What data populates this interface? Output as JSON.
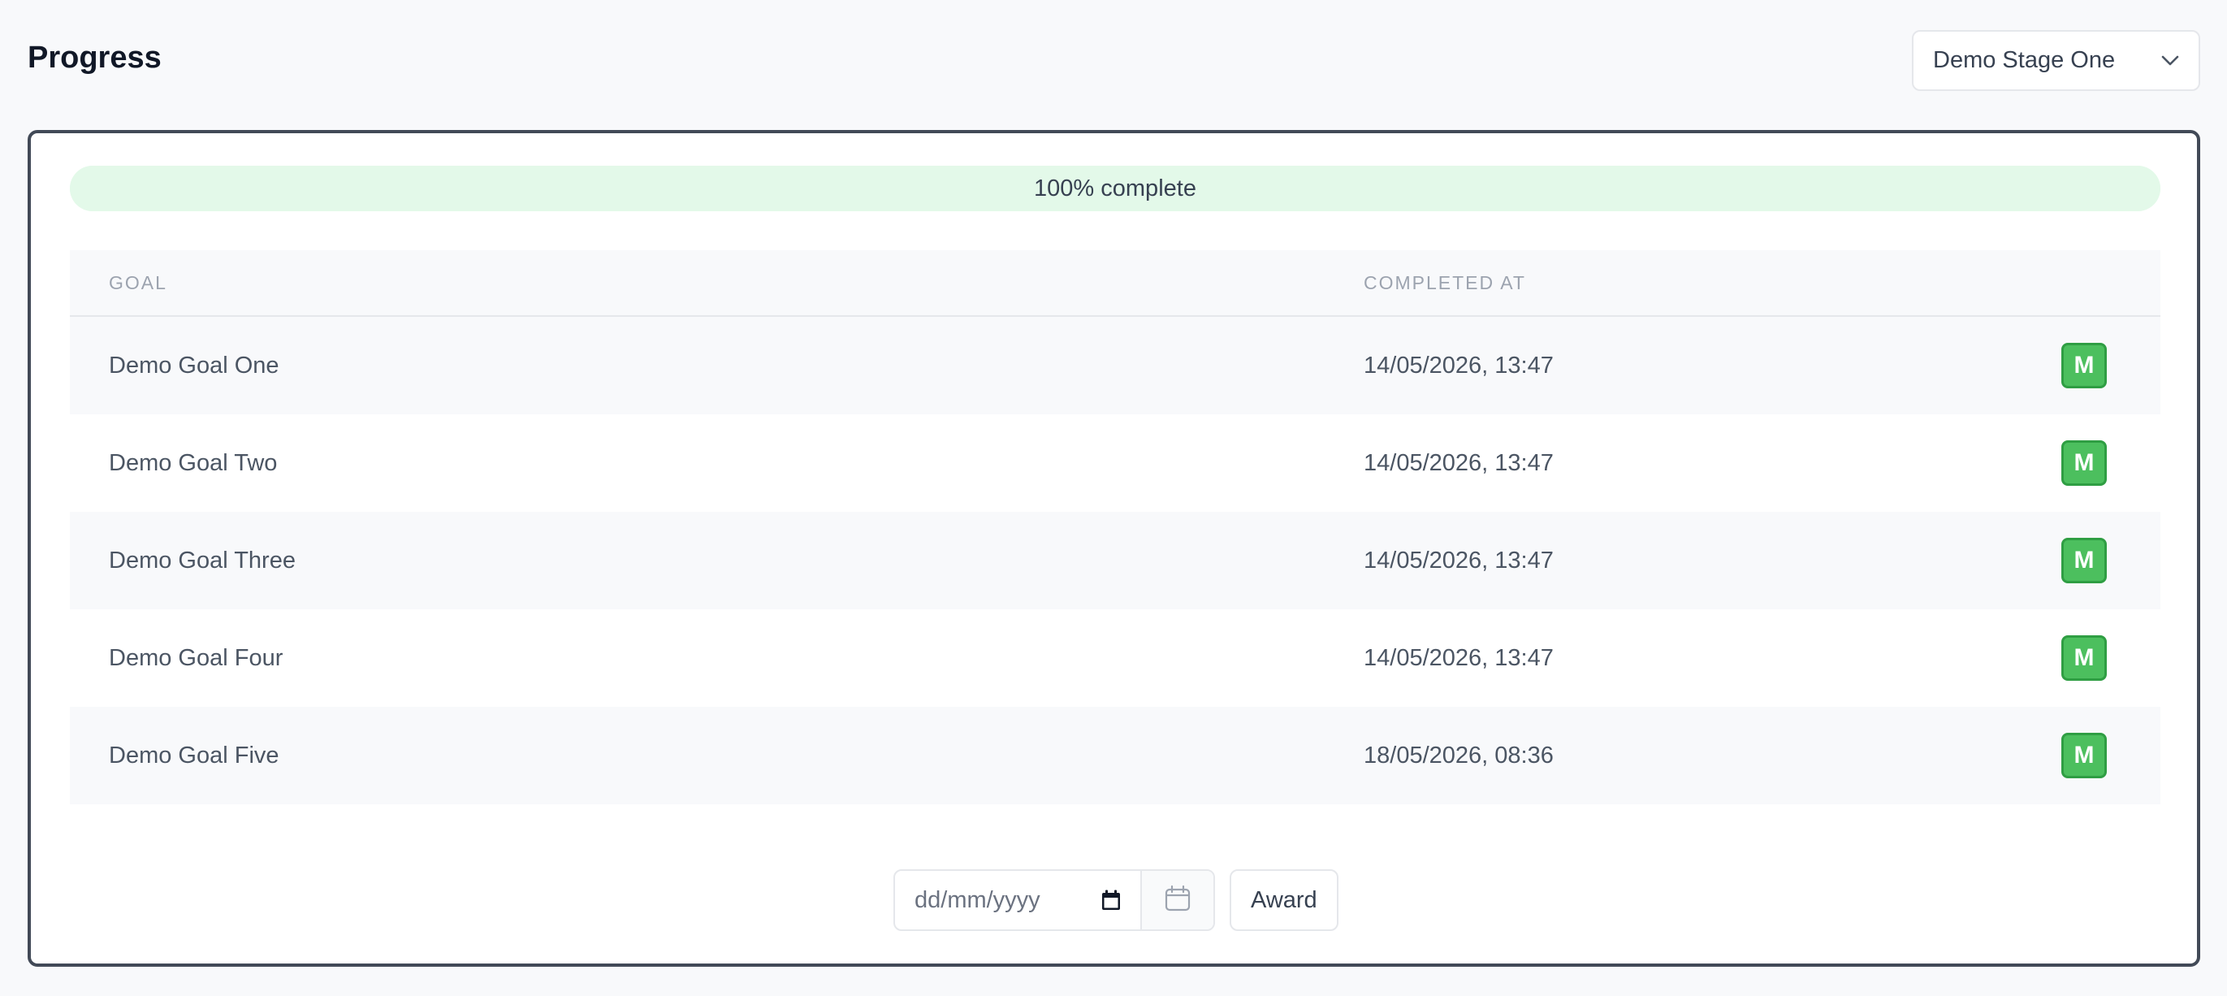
{
  "header": {
    "title": "Progress",
    "stage_select": {
      "selected": "Demo Stage One"
    }
  },
  "progress": {
    "label": "100% complete",
    "fraction": 1.0
  },
  "table": {
    "columns": [
      "GOAL",
      "COMPLETED AT",
      ""
    ],
    "rows": [
      {
        "goal": "Demo Goal One",
        "completed_at": "14/05/2026, 13:47",
        "badge": "M"
      },
      {
        "goal": "Demo Goal Two",
        "completed_at": "14/05/2026, 13:47",
        "badge": "M"
      },
      {
        "goal": "Demo Goal Three",
        "completed_at": "14/05/2026, 13:47",
        "badge": "M"
      },
      {
        "goal": "Demo Goal Four",
        "completed_at": "14/05/2026, 13:47",
        "badge": "M"
      },
      {
        "goal": "Demo Goal Five",
        "completed_at": "18/05/2026, 08:36",
        "badge": "M"
      }
    ]
  },
  "award": {
    "date_placeholder": "dd/mm/yyyy",
    "button_label": "Award"
  },
  "icons": {
    "select": "chevron-down-icon",
    "date_input": "calendar-icon",
    "date_picker": "calendar-icon"
  },
  "colors": {
    "progress_bg": "#e3f9e9",
    "badge_green": "#4cbf5e",
    "card_border": "#424a57"
  }
}
